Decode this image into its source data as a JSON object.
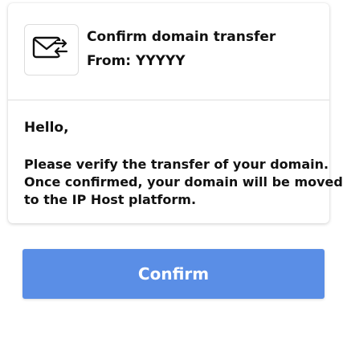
{
  "email": {
    "icon": "mail-transfer-icon",
    "subject": "Confirm domain transfer",
    "from": "From: YYYYY",
    "greeting": "Hello,",
    "body_lines": [
      "Please verify the transfer of your domain.",
      "Once confirmed, your domain will be moved",
      "to the IP Host platform."
    ]
  },
  "actions": {
    "confirm_label": "Confirm"
  },
  "colors": {
    "button": "#5a8ee6",
    "button_text": "#ffffff",
    "text": "#111111"
  }
}
